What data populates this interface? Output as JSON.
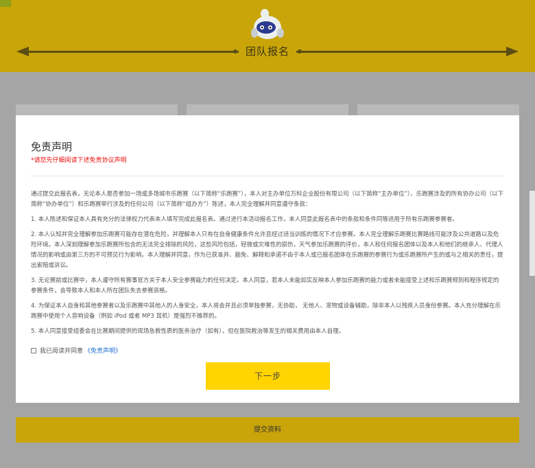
{
  "header": {
    "title": "团队报名",
    "mascot_icon": "mascot-icon",
    "accent_color": "#c9a50a"
  },
  "submit": {
    "label": "提交资料"
  },
  "modal": {
    "title": "免责声明",
    "warning": "*请您先仔细阅读下述免责协议声明",
    "paragraphs": [
      "通过提交此报名表，无论本人是否参加一场或多场城市乐跑赛（以下简称“乐跑赛”），本人对主办单位万科企业股份有限公司（以下简称“主办单位”）、乐跑赛涉及的所有协办公司（以下简称“协办单位”）和乐跑赛举行涉及的任何公司（以下简称“组办方”）陈述，本人完全理解并同意遵守条款：",
      "1. 本人陈述和保证本人具有充分的法律权力代表本人填写完成此报名表。通过进行本活动报名工作，本人同意此报名表中的条款和条件同等适用于所有乐跑赛参赛者。",
      "2. 本人认知并完全理解参加乐跑赛可能存在潜在危险，并理解本人只有在自身健康条件允许且经过适当训练的情况下才应参赛。本人完全理解乐跑赛比赛路线可能涉及公共道路以及危险环境。本人深刻理解参加乐跑赛所包含的无法完全排除的风险，这些风险包括，轻微或灾难性的损伤，天气参加乐跑赛的评价，本人和任何报名团体以及本人和他们的继承人、代理人情况的影响或由第三方的不可预见行为影响。本人理解并同意，作为已获准并、豁免、解释和承诺不由于本人或已报名团体在乐跑赛的参赛行为或乐跑赛所产生的或与之相关的责任，提出索赔或诉讼。",
      "3. 无论赛前或比赛中，本人遵守所有赛事官方关于本人安全参赛能力的任何决定。本人同意，若本人未能如实反映本人参加乐跑赛的能力或者未能接受上述和乐跑赛规则和程序规定的参赛条件，会导致本人和本人所在团队失去参赛资格。",
      "4. 为保证本人自身和其他参赛者以及乐跑赛中其他人的人身安全，本人将会并且必须单独参赛，无协助， 无他人、宠物或设备辅助，除非本人以残疾人员身份参赛。本人充分理解在乐跑赛中使用个人音响设备（例如 iPod 或者 MP3 耳机）是强烈不推荐的。",
      "5. 本人同意接受组委会在比赛期间提供的现场急救性质的医务治疗（如有），但在医院救治等发生的相关费用由本人自理。"
    ],
    "agree_text": "我已阅读并同意",
    "agree_link": "《免责声明》",
    "agree_checked": false,
    "next_label": "下一步",
    "next_color": "#ffd400"
  }
}
